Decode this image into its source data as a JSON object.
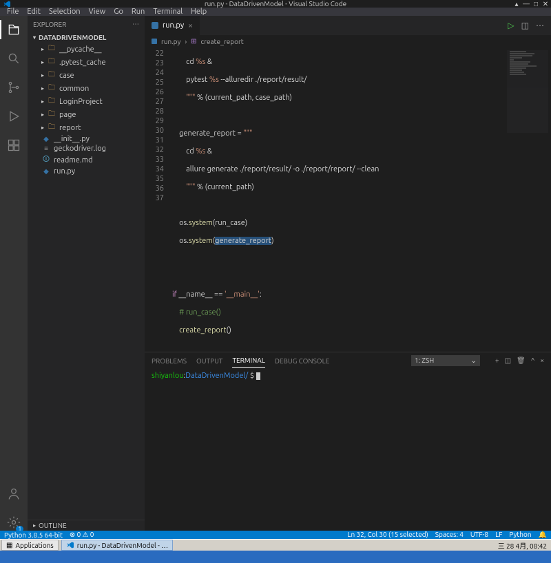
{
  "title": "run.py - DataDrivenModel - Visual Studio Code",
  "menu": [
    "File",
    "Edit",
    "Selection",
    "View",
    "Go",
    "Run",
    "Terminal",
    "Help"
  ],
  "explorer": {
    "title": "EXPLORER",
    "project": "DATADRIVENMODEL",
    "items": [
      {
        "label": "__pycache__",
        "type": "folder"
      },
      {
        "label": ".pytest_cache",
        "type": "folder"
      },
      {
        "label": "case",
        "type": "folder"
      },
      {
        "label": "common",
        "type": "folder"
      },
      {
        "label": "LoginProject",
        "type": "folder"
      },
      {
        "label": "page",
        "type": "folder"
      },
      {
        "label": "report",
        "type": "folder"
      },
      {
        "label": "__init__.py",
        "type": "py"
      },
      {
        "label": "geckodriver.log",
        "type": "file"
      },
      {
        "label": "readme.md",
        "type": "md"
      },
      {
        "label": "run.py",
        "type": "py"
      }
    ],
    "outline": "OUTLINE"
  },
  "tab": {
    "file": "run.py"
  },
  "breadcrumb": {
    "file": "run.py",
    "symbol": "create_report"
  },
  "code_lines": [
    22,
    23,
    24,
    25,
    26,
    27,
    28,
    29,
    30,
    31,
    32,
    33,
    34,
    35,
    36,
    37
  ],
  "panel": {
    "tabs": [
      "PROBLEMS",
      "OUTPUT",
      "TERMINAL",
      "DEBUG CONSOLE"
    ],
    "activeTab": "TERMINAL",
    "shellLabel": "1: zsh",
    "prompt_user": "shiyanlou",
    "prompt_sep": ":",
    "prompt_path": "DataDrivenModel/",
    "prompt_sym": " $ "
  },
  "status": {
    "python": "Python 3.8.5 64-bit",
    "errors": "⊗ 0 ⚠ 0",
    "cursor": "Ln 32, Col 30 (15 selected)",
    "spaces": "Spaces: 4",
    "encoding": "UTF-8",
    "eol": "LF",
    "lang": "Python",
    "bell": "🔔"
  },
  "taskbar": {
    "apps": "Applications",
    "task": "run.py - DataDrivenModel - …",
    "clock": "三 28 4月, 08:42"
  }
}
